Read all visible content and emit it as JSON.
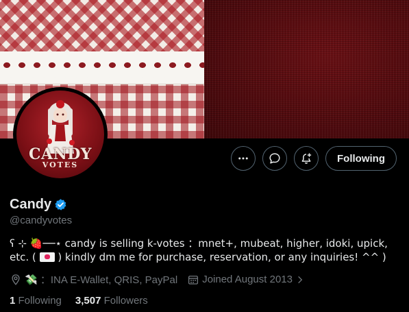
{
  "profile": {
    "display_name": "Candy",
    "handle": "@candyvotes",
    "bio": "ʕ ⊹ 🍓──⋆ candy is selling k-votes ：mnet+, mubeat, higher, idoki, upick, etc. (",
    "bio_end": ") kindly dm me for purchase, reservation, or any inquiries! ^^ )",
    "location": "💸 ：INA E-Wallet, QRIS, PayPal",
    "joined": "Joined August 2013"
  },
  "avatar": {
    "title": "CANDY",
    "subtitle": "VOTES"
  },
  "actions": {
    "following_label": "Following"
  },
  "stats": {
    "following_count": "1",
    "following_label": "Following",
    "followers_count": "3,507",
    "followers_label": "Followers"
  },
  "colors": {
    "background": "#000000",
    "text_primary": "#e7e9ea",
    "text_secondary": "#71767b",
    "verified_blue": "#1d9bf0",
    "button_border": "#536471",
    "banner_red": "#4f0a0e"
  },
  "icons": {
    "more": "more-icon",
    "message": "message-icon",
    "notify": "notification-add-icon",
    "verified": "verified-badge-icon",
    "location": "location-icon",
    "calendar": "calendar-icon",
    "chevron": "chevron-right-icon"
  }
}
